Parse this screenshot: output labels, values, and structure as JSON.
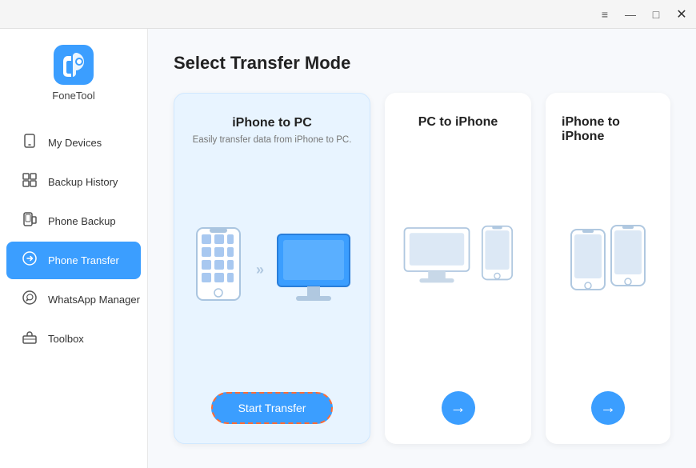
{
  "titleBar": {
    "menu_icon": "≡",
    "minimize_icon": "—",
    "maximize_icon": "□",
    "close_icon": "✕"
  },
  "sidebar": {
    "logo_text": "FoneTool",
    "items": [
      {
        "id": "my-devices",
        "label": "My Devices",
        "icon": "device"
      },
      {
        "id": "backup-history",
        "label": "Backup History",
        "icon": "history"
      },
      {
        "id": "phone-backup",
        "label": "Phone Backup",
        "icon": "backup"
      },
      {
        "id": "phone-transfer",
        "label": "Phone Transfer",
        "icon": "transfer",
        "active": true
      },
      {
        "id": "whatsapp-manager",
        "label": "WhatsApp Manager",
        "icon": "whatsapp"
      },
      {
        "id": "toolbox",
        "label": "Toolbox",
        "icon": "toolbox"
      }
    ]
  },
  "main": {
    "page_title": "Select Transfer Mode",
    "cards": [
      {
        "id": "iphone-to-pc",
        "title": "iPhone to PC",
        "subtitle": "Easily transfer data from iPhone to PC.",
        "active": true,
        "action_type": "button",
        "action_label": "Start Transfer"
      },
      {
        "id": "pc-to-iphone",
        "title": "PC to iPhone",
        "subtitle": "",
        "active": false,
        "action_type": "arrow",
        "action_label": "→"
      },
      {
        "id": "iphone-to-iphone",
        "title": "iPhone to iPhone",
        "subtitle": "",
        "active": false,
        "action_type": "arrow",
        "action_label": "→"
      }
    ]
  }
}
